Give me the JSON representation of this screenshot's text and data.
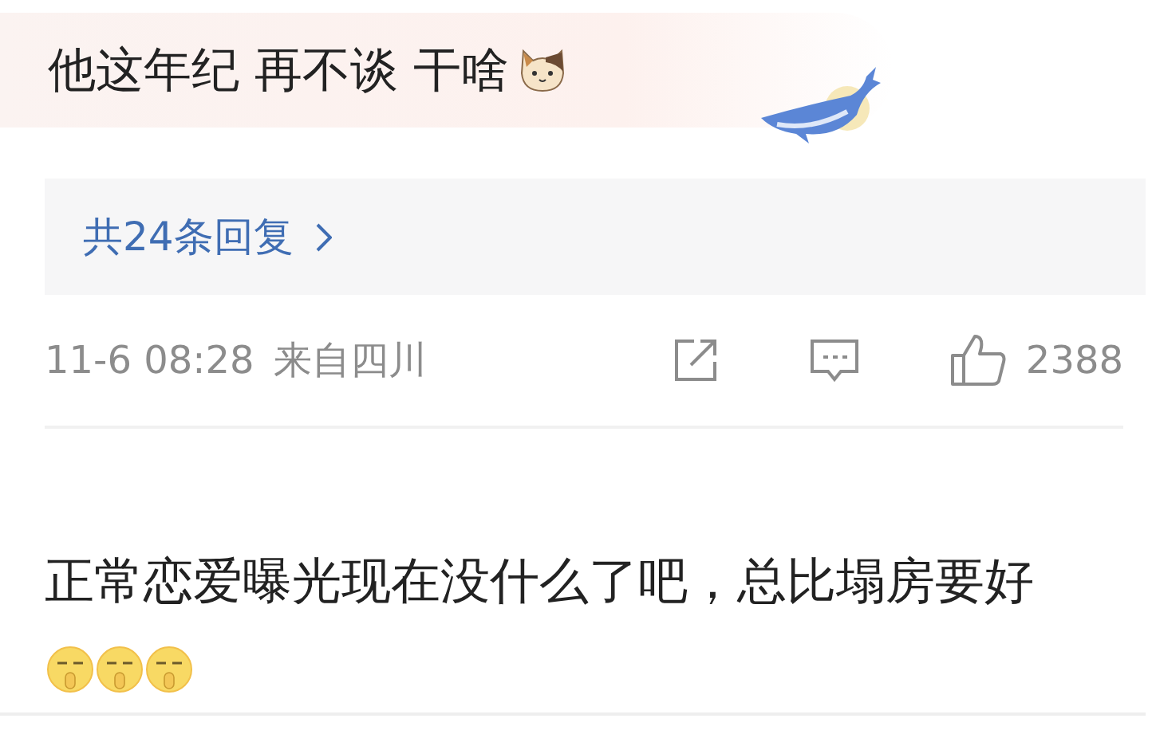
{
  "comment": {
    "text": "他这年纪 再不谈 干啥",
    "emojis": [
      {
        "kind": "cat"
      }
    ]
  },
  "replies": {
    "label": "共24条回复"
  },
  "meta": {
    "time": "11-6 08:28",
    "location": "来自四川",
    "likes": "2388"
  },
  "next_comment": {
    "text": "正常恋爱曝光现在没什么了吧，总比塌房要好",
    "emojis": [
      {
        "kind": "shush"
      },
      {
        "kind": "shush"
      },
      {
        "kind": "shush"
      }
    ]
  }
}
